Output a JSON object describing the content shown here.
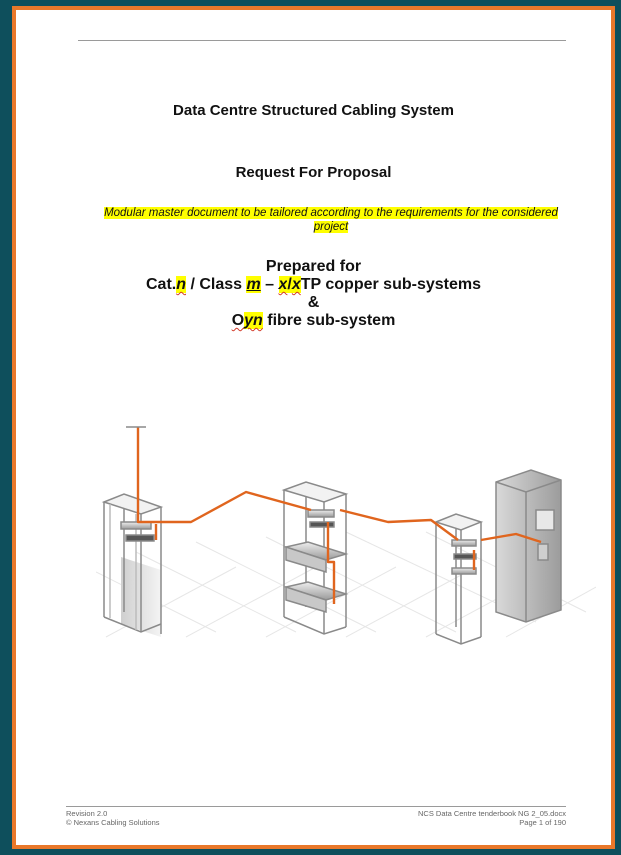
{
  "document": {
    "title": "Data Centre Structured Cabling System",
    "subtitle": "Request For Proposal",
    "note": "Modular master document to be tailored according to the requirements for the considered project",
    "prepared_for": {
      "label": "Prepared for",
      "copper_prefix": "Cat.",
      "copper_n": "n",
      "copper_mid": " / Class ",
      "copper_m": "m",
      "copper_dash": " – ",
      "copper_x1": "x",
      "copper_slash": "/",
      "copper_x2": "x",
      "copper_suffix": "TP copper sub-systems",
      "ampersand": "&",
      "fibre_prefix": "O",
      "fibre_yn": "yn",
      "fibre_suffix": " fibre sub-system"
    }
  },
  "footer": {
    "revision": "Revision 2.0",
    "copyright": "© Nexans Cabling Solutions",
    "filename": "NCS Data Centre tenderbook NG 2_05.docx",
    "page": "Page 1 of 190"
  },
  "colors": {
    "background": "#0e4f5c",
    "frame": "#e9782a",
    "highlight": "#ffff00",
    "cable": "#e0651e"
  },
  "illustration": {
    "icon": "server-racks-cabling-illustration"
  }
}
